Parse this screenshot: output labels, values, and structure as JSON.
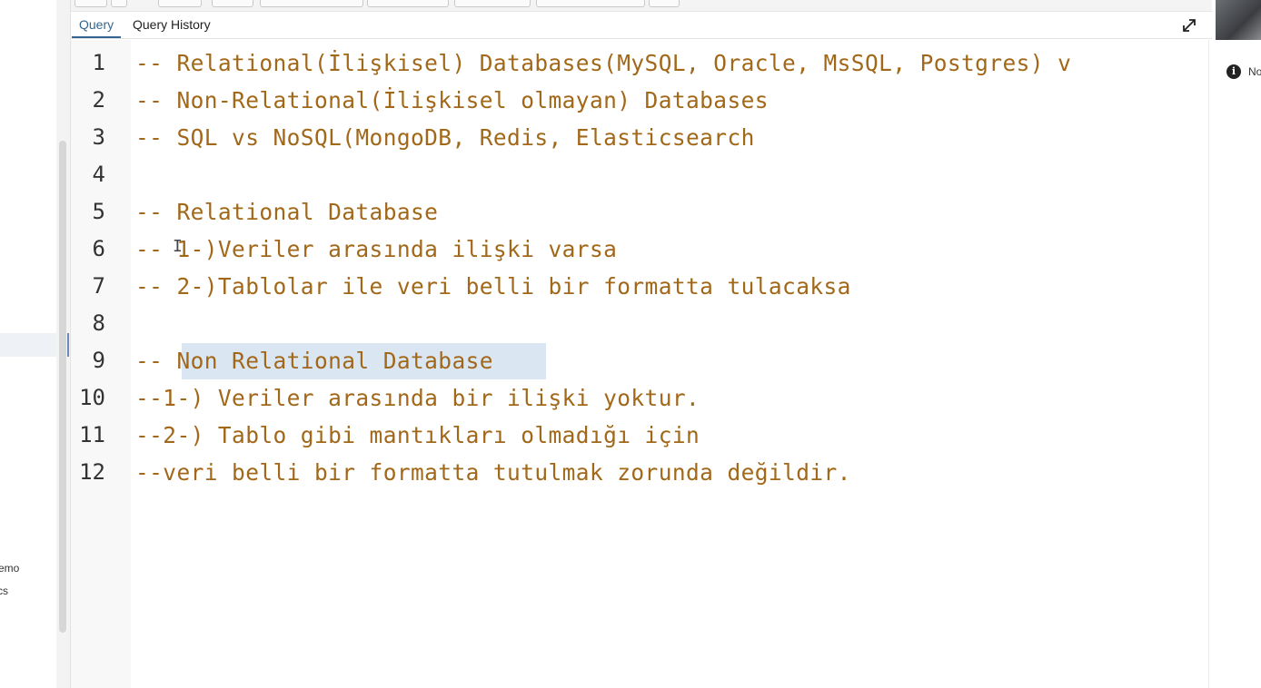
{
  "tabs": {
    "query": "Query",
    "history": "Query History"
  },
  "editor": {
    "lines": [
      {
        "no": "1",
        "text": "-- Relational(İlişkisel) Databases(MySQL, Oracle, MsSQL, Postgres) v"
      },
      {
        "no": "2",
        "text": "-- Non-Relational(İlişkisel olmayan) Databases"
      },
      {
        "no": "3",
        "text": "-- SQL vs NoSQL(MongoDB, Redis, Elasticsearch"
      },
      {
        "no": "4",
        "text": ""
      },
      {
        "no": "5",
        "text": "-- Relational Database"
      },
      {
        "no": "6",
        "text": "-- 1-)Veriler arasında ilişki varsa"
      },
      {
        "no": "7",
        "text": "-- 2-)Tablolar ile veri belli bir formatta tulacaksa"
      },
      {
        "no": "8",
        "text": ""
      },
      {
        "no": "9",
        "text": "-- Non Relational Database"
      },
      {
        "no": "10",
        "text": "--1-) Veriler arasında bir ilişki yoktur."
      },
      {
        "no": "11",
        "text": "--2-) Tablo gibi mantıkları olmadığı için"
      },
      {
        "no": "12",
        "text": "--veri belli bir formatta tutulmak zorunda değildir."
      }
    ]
  },
  "left_panel": {
    "item_1": "emo",
    "item_2": "cs"
  },
  "right_panel": {
    "info_text": "No"
  },
  "colors": {
    "comment": "#a2681a",
    "selection": "#dbe6f3",
    "active_tab": "#326690"
  }
}
